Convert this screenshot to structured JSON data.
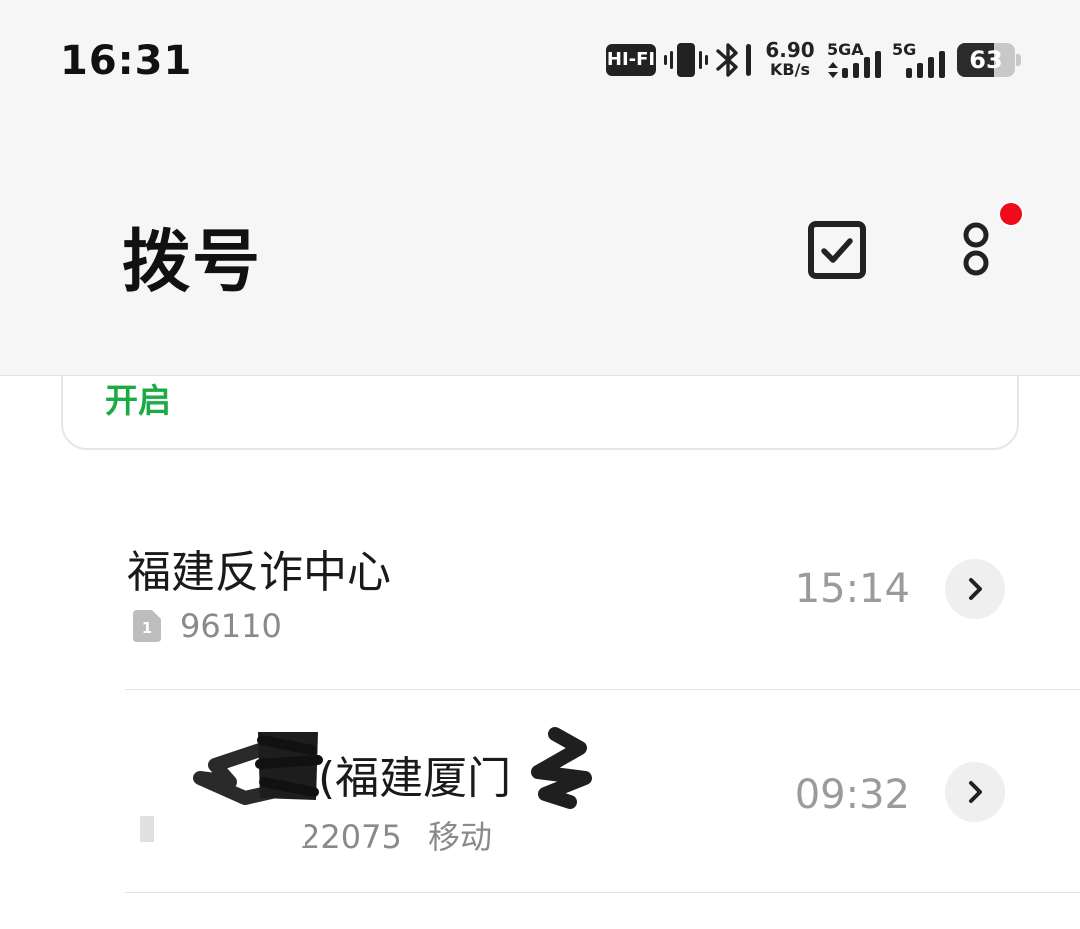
{
  "status_bar": {
    "time": "16:31",
    "hifi_label": "HI-FI",
    "net_speed_value": "6.90",
    "net_speed_unit": "KB/s",
    "sim1_label": "5GA",
    "sim2_label": "5G",
    "battery_level": "63",
    "battery_fraction": 0.63,
    "icons": [
      "vibrate-icon",
      "bluetooth-icon",
      "signal-icon"
    ]
  },
  "header": {
    "title": "拨号",
    "select_icon": "checkbox-icon",
    "more_icon": "more-icon",
    "notification_color": "#f00a1a"
  },
  "banner": {
    "enable_label": "开启",
    "accent_color": "#1aab45"
  },
  "calls": [
    {
      "name": "福建反诈中心",
      "sim": "1",
      "number": "96110",
      "carrier": "",
      "time": "15:14"
    },
    {
      "name": "(福建厦门",
      "sim": "",
      "number": "22075",
      "carrier": "移动",
      "time": "09:32"
    }
  ]
}
